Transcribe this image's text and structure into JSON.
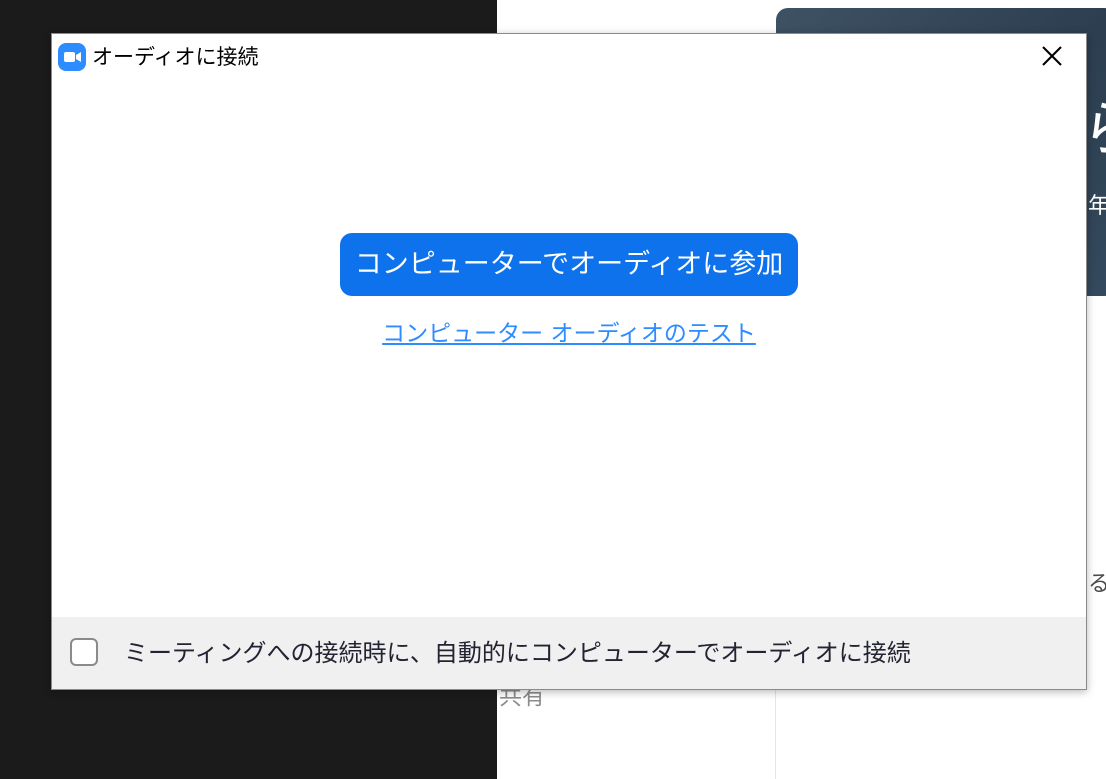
{
  "dialog": {
    "title": "オーディオに接続",
    "app_icon": "zoom-video-camera-icon",
    "close_icon": "close-icon",
    "join_button_label": "コンピューターでオーディオに参加",
    "test_link_label": "コンピューター オーディオのテスト",
    "auto_join_checkbox": {
      "label": "ミーティングへの接続時に、自動的にコンピューターでオーディオに接続",
      "checked": false
    }
  },
  "background": {
    "banner_glyph": "ら",
    "banner_year_char": "年",
    "peek_text": "る",
    "share_label": "共有"
  },
  "colors": {
    "accent_blue": "#0e72ed",
    "link_blue": "#2d8cff",
    "icon_blue": "#2d8cff",
    "footer_bg": "#f0f0f0"
  }
}
